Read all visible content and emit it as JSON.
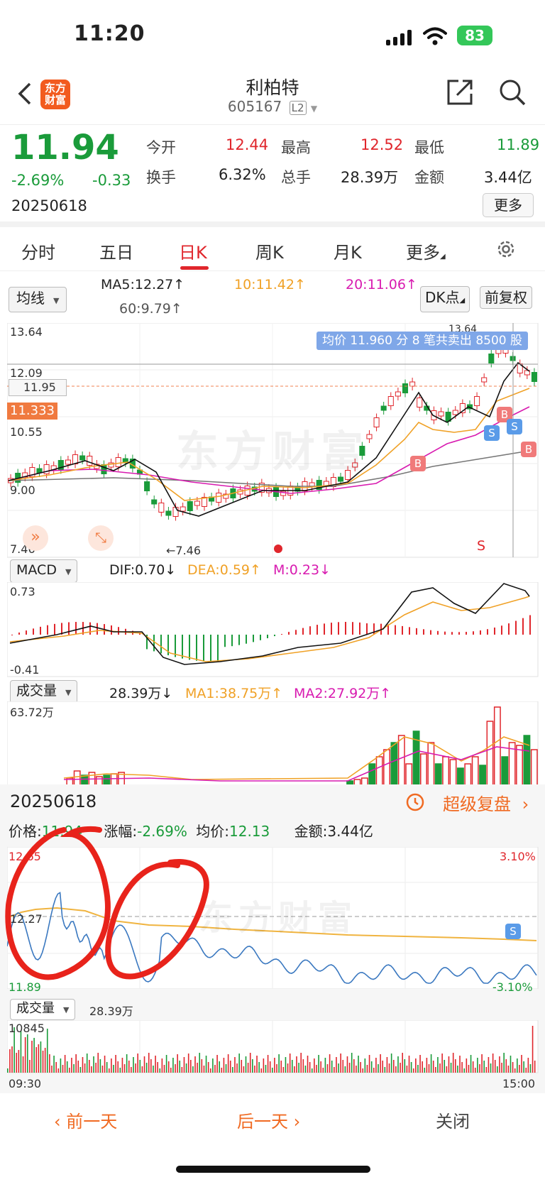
{
  "status_bar": {
    "time": "11:20",
    "battery": "83"
  },
  "header": {
    "logo_text": "东方财富",
    "stock_name": "利柏特",
    "stock_code": "605167",
    "level_badge": "L2"
  },
  "quote": {
    "price": "11.94",
    "change_pct": "-2.69%",
    "change": "-0.33",
    "date": "20250618",
    "open_label": "今开",
    "open": "12.44",
    "high_label": "最高",
    "high": "12.52",
    "low_label": "最低",
    "low": "11.89",
    "turnover_label": "换手",
    "turnover": "6.32%",
    "volume_label": "总手",
    "volume": "28.39万",
    "amount_label": "金额",
    "amount": "3.44亿",
    "more_button": "更多"
  },
  "tabs": {
    "t1": "分时",
    "t2": "五日",
    "t3": "日K",
    "t4": "周K",
    "t5": "月K",
    "t6": "更多"
  },
  "kline": {
    "indicator_select": "均线",
    "ma5": "MA5:12.27↑",
    "ma10": "10:11.42↑",
    "ma20": "20:11.06↑",
    "ma60": "60:9.79↑",
    "dk_button": "DK点",
    "adjust_button": "前复权",
    "y_top": "13.64",
    "y_2": "12.09",
    "y_3": "10.55",
    "y_4": "9.00",
    "y_bottom": "7.46",
    "crosshair_price": "11.95",
    "current_price_tag": "11.333",
    "high_marker": "13.64",
    "low_marker": "←7.46",
    "tooltip": "均价 11.960 分 8 笔共卖出 8500 股",
    "watermark": "东方财富",
    "signal_b": "B",
    "signal_s": "S"
  },
  "macd": {
    "select": "MACD",
    "dif": "DIF:0.70↓",
    "dea": "DEA:0.59↑",
    "m": "M:0.23↓",
    "y_top": "0.73",
    "y_bottom": "-0.41"
  },
  "volume": {
    "select": "成交量",
    "value": "28.39万↓",
    "ma1": "MA1:38.75万↑",
    "ma2": "MA2:27.92万↑",
    "y_top": "63.72万"
  },
  "review": {
    "date": "20250618",
    "replay_label": "超级复盘",
    "price_label": "价格:",
    "price": "11.94",
    "change_label": "涨幅:",
    "change": "-2.69%",
    "avg_label": "均价:",
    "avg": "12.13",
    "amount_label": "金额:",
    "amount": "3.44亿",
    "y_top": "12.65",
    "y_mid": "12.27",
    "y_bottom": "11.89",
    "pct_top": "3.10%",
    "pct_bottom": "-3.10%",
    "vol_select": "成交量",
    "vol_value": "28.39万",
    "vol_top": "10845",
    "time_start": "09:30",
    "time_end": "15:00",
    "signal_s": "S"
  },
  "footer": {
    "prev": "前一天",
    "next": "后一天",
    "close": "关闭"
  }
}
